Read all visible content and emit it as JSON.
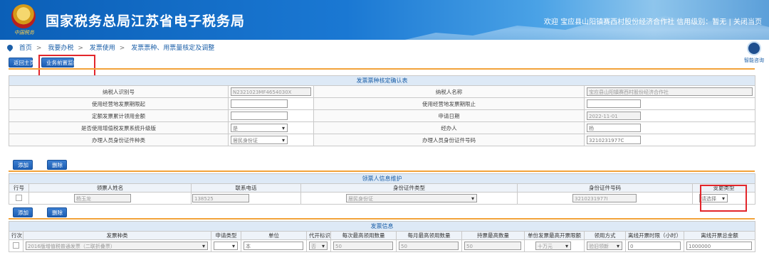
{
  "header": {
    "title": "国家税务总局江苏省电子税务局",
    "emblem_caption": "中国税务",
    "welcome": "欢迎 宝应县山阳镇赛西村股份经济合作社  信用级别：暂无  |  关闭当页"
  },
  "breadcrumb": [
    "首页",
    "我要办税",
    "发票使用",
    "发票票种、用票量核定及调整"
  ],
  "assistant_label": "智能咨询",
  "toolbar": {
    "home": "返回主页",
    "monitor": "业务前置监控"
  },
  "form1": {
    "caption": "发票票种核定确认表",
    "rows": [
      {
        "l1": "纳税人识别号",
        "v1": "N2321023MF4654030X",
        "l2": "纳税人名称",
        "v2": "宝应县山阳镇赛西村股份经济合作社"
      },
      {
        "l1": "使用经营地发票期限起",
        "v1": "",
        "l2": "使用经营地发票期限止",
        "v2": ""
      },
      {
        "l1": "定额发票累计领用金额",
        "v1": "",
        "l2": "申请日期",
        "v2": "2022-11-01"
      },
      {
        "l1": "是否使用增值税发票系统升级版",
        "v1": "是",
        "l2": "经办人",
        "v2": "杨"
      },
      {
        "l1": "办理人员身份证件种类",
        "v1": "居民身份证",
        "l2": "办理人员身份证件号码",
        "v2": "3210231977C"
      }
    ]
  },
  "buttons": {
    "add": "添加",
    "delete": "删除"
  },
  "form2": {
    "caption": "领票人信息维护",
    "headers": [
      "行号",
      "领票人姓名",
      "联系电话",
      "身份证件类型",
      "身份证件号码",
      "变更类型"
    ],
    "row": {
      "name": "杨玉龙",
      "phone": "138525",
      "id_type": "居民身份证",
      "id_no": "3210231977I",
      "change": "请选择"
    }
  },
  "form3": {
    "caption": "发票信息",
    "headers": [
      "行次",
      "发票种类",
      "申请类型",
      "单位",
      "代开标识",
      "每次最高领用数量",
      "每月最高领用数量",
      "持票最高数量",
      "单份发票最高开票限额",
      "领用方式",
      "离线开票时限（小时）",
      "离线开票总金额"
    ],
    "row": {
      "kind": "2016版增值税普通发票（二联折叠票）",
      "apply": "",
      "unit": "本",
      "agent": "否",
      "per_time": "50",
      "per_month": "50",
      "hold": "50",
      "limit": "十万元",
      "method": "验旧领新",
      "offline_hours": "0",
      "offline_amount": "1000000"
    }
  },
  "colors": {
    "header_blue": "#0b5fb7",
    "button_blue": "#1c5eb4",
    "accent_orange": "#f2a33a",
    "highlight_red": "#e3262b",
    "caption_bg": "#dde9f6"
  }
}
